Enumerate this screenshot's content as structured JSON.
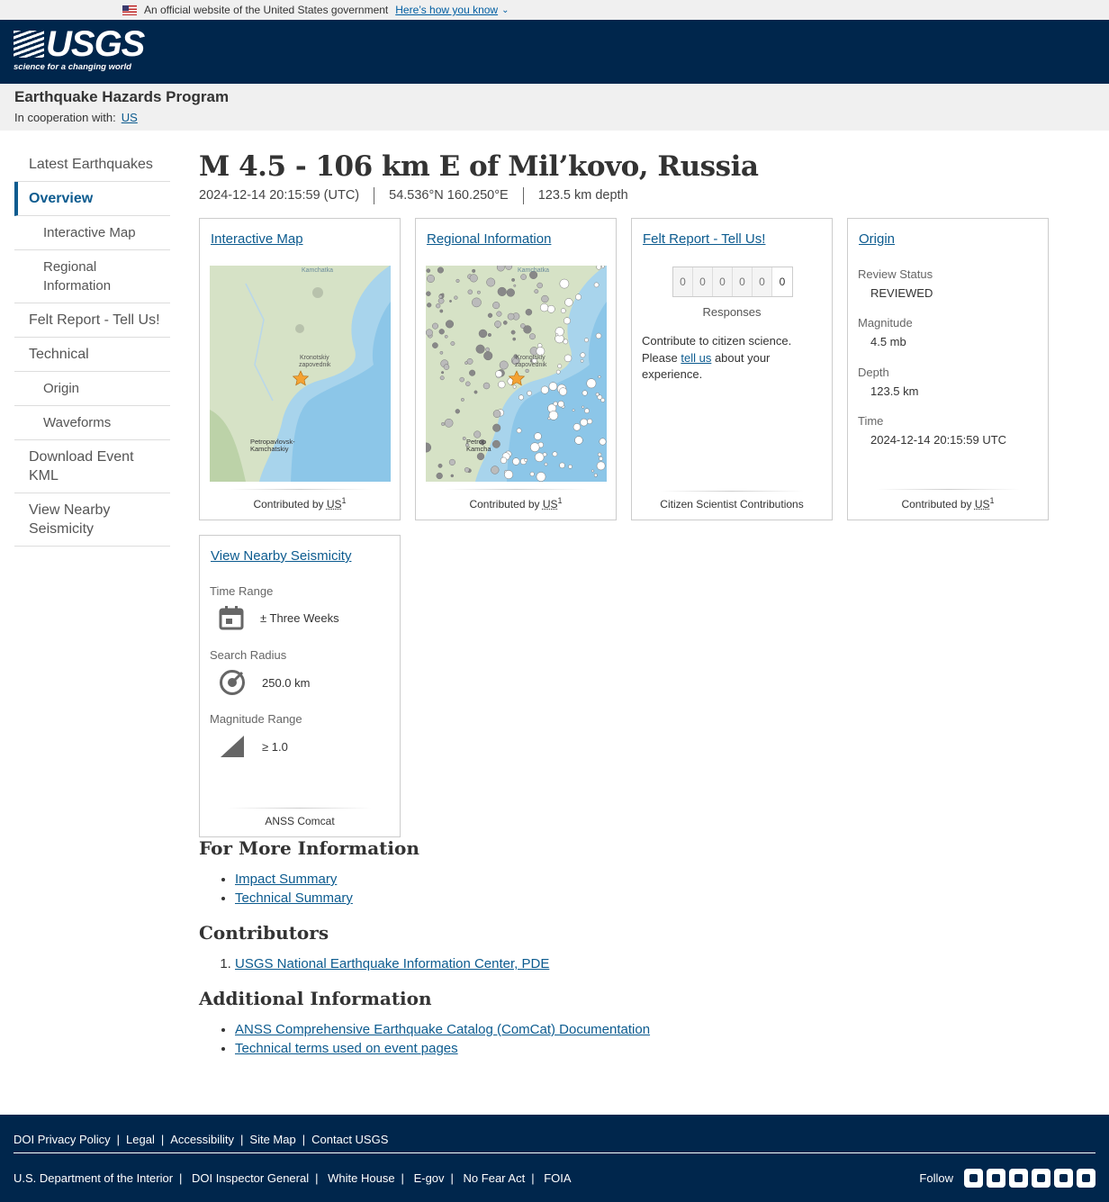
{
  "gov_banner": {
    "text": "An official website of the United States government",
    "link": "Here’s how you know",
    "icon": "us-flag-icon"
  },
  "header": {
    "logo_text": "USGS",
    "logo_tagline": "science for a changing world"
  },
  "site": {
    "title": "Earthquake Hazards Program",
    "coop_label": "In cooperation with:",
    "coop_link": "US"
  },
  "sidenav": {
    "items": [
      {
        "label": "Latest Earthquakes"
      },
      {
        "label": "Overview",
        "active": true
      },
      {
        "label": "Interactive Map"
      },
      {
        "label": "Regional Information"
      },
      {
        "label": "Felt Report - Tell Us!"
      },
      {
        "label": "Technical"
      },
      {
        "label": "Origin"
      },
      {
        "label": "Waveforms"
      },
      {
        "label": "Download Event KML"
      },
      {
        "label": "View Nearby Seismicity"
      }
    ]
  },
  "event": {
    "title": "M 4.5 - 106 km E of Mil’kovo, Russia",
    "time": "2024-12-14 20:15:59 (UTC)",
    "location": "54.536°N 160.250°E",
    "depth": "123.5 km depth"
  },
  "cards": {
    "map": {
      "title": "Interactive Map",
      "footer_prefix": "Contributed by",
      "footer_link": "US",
      "footer_sup": "1",
      "labels": {
        "top": "Kamchatka",
        "reserve1": "Kronotskiy",
        "reserve2": "zapovednik",
        "city1": "Petropavlovsk-",
        "city2": "Kamchatskiy"
      }
    },
    "regional": {
      "title": "Regional Information",
      "footer_prefix": "Contributed by",
      "footer_link": "US",
      "footer_sup": "1",
      "labels": {
        "top": "Kamchatka",
        "reserve1": "Kronotskiy",
        "reserve2": "zapovednik",
        "city1": "Petrop",
        "city2": "Kamcha"
      }
    },
    "felt": {
      "title": "Felt Report - Tell Us!",
      "digits": [
        "0",
        "0",
        "0",
        "0",
        "0",
        "0"
      ],
      "responses_label": "Responses",
      "text_before": "Contribute to citizen science. Please ",
      "text_link": "tell us",
      "text_after": " about your experience.",
      "footer": "Citizen Scientist Contributions"
    },
    "origin": {
      "title": "Origin",
      "review_status_label": "Review Status",
      "review_status": "REVIEWED",
      "magnitude_label": "Magnitude",
      "magnitude": "4.5 mb",
      "depth_label": "Depth",
      "depth": "123.5 km",
      "time_label": "Time",
      "time": "2024-12-14 20:15:59 UTC",
      "footer_prefix": "Contributed by",
      "footer_link": "US",
      "footer_sup": "1"
    },
    "nearby": {
      "title": "View Nearby Seismicity",
      "time_range_label": "Time Range",
      "time_range": "± Three Weeks",
      "radius_label": "Search Radius",
      "radius": "250.0 km",
      "mag_label": "Magnitude Range",
      "mag": "≥ 1.0",
      "footer": "ANSS Comcat"
    }
  },
  "more_info": {
    "heading": "For More Information",
    "links": [
      "Impact Summary",
      "Technical Summary"
    ]
  },
  "contributors": {
    "heading": "Contributors",
    "items": [
      "USGS National Earthquake Information Center, PDE"
    ]
  },
  "additional": {
    "heading": "Additional Information",
    "links": [
      "ANSS Comprehensive Earthquake Catalog (ComCat) Documentation",
      "Technical terms used on event pages"
    ]
  },
  "footer": {
    "row1": [
      "DOI Privacy Policy",
      "Legal",
      "Accessibility",
      "Site Map",
      "Contact USGS"
    ],
    "row2": [
      "U.S. Department of the Interior",
      "DOI Inspector General",
      "White House",
      "E-gov",
      "No Fear Act",
      "FOIA"
    ],
    "follow_label": "Follow",
    "social_icons": [
      "twitter-icon",
      "facebook-icon",
      "github-icon",
      "flickr-icon",
      "youtube-icon",
      "instagram-icon"
    ]
  },
  "colors": {
    "header_bg": "#00264c",
    "link": "#0c5b8f",
    "marker": "#f4a233"
  }
}
